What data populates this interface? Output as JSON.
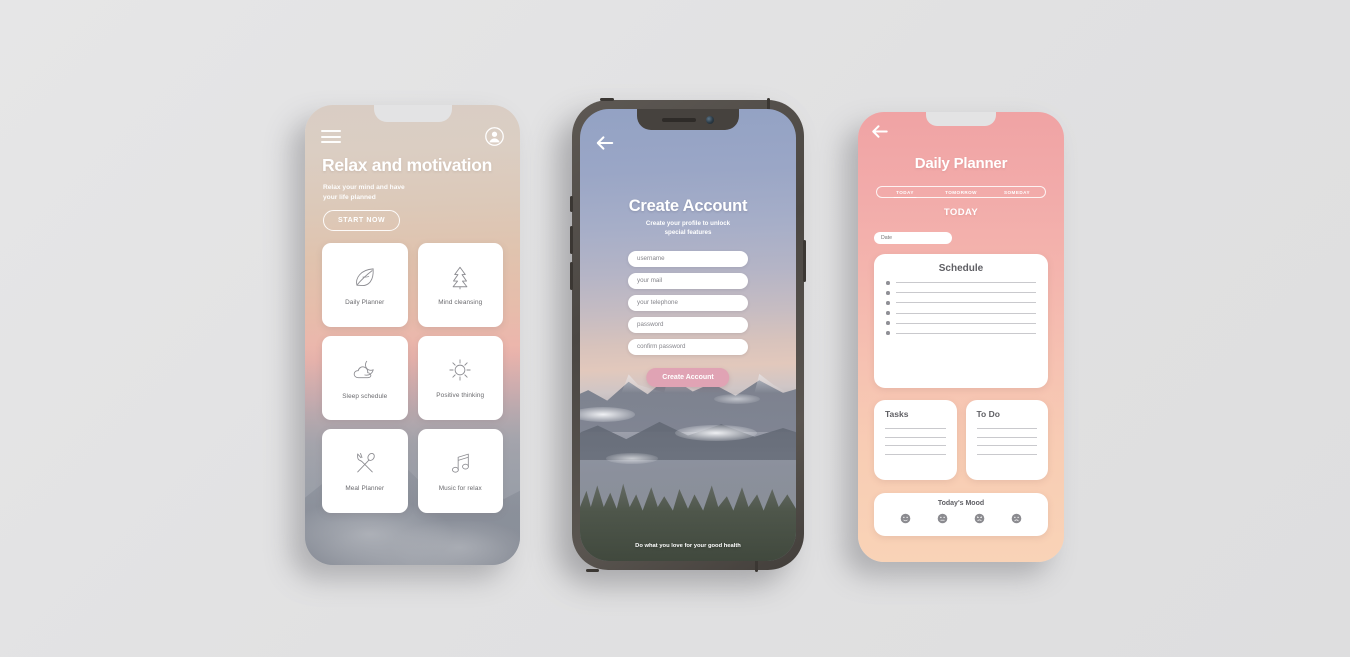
{
  "canvas": {
    "background": "#e3e3e4"
  },
  "phone1": {
    "name": "relax-and-motivation-home",
    "menu_icon": "hamburger-menu-icon",
    "account_icon": "account-avatar-icon",
    "title": "Relax and motivation",
    "subtitle": "Relax your mind and have\nyour life planned",
    "cta_label": "START NOW",
    "tiles": [
      {
        "label": "Daily Planner",
        "icon": "leaf-icon"
      },
      {
        "label": "Mind cleansing",
        "icon": "pine-tree-icon"
      },
      {
        "label": "Sleep schedule",
        "icon": "moon-cloud-icon"
      },
      {
        "label": "Positive thinking",
        "icon": "sun-icon"
      },
      {
        "label": "Meal Planner",
        "icon": "fork-spoon-icon"
      },
      {
        "label": "Music for relax",
        "icon": "music-note-icon"
      }
    ]
  },
  "phone2": {
    "name": "create-account-screen",
    "back_icon": "back-arrow-icon",
    "title": "Create Account",
    "subtitle": "Create your profile to unlock\nspecial features",
    "fields": [
      {
        "placeholder": "username"
      },
      {
        "placeholder": "your mail"
      },
      {
        "placeholder": "your telephone"
      },
      {
        "placeholder": "password"
      },
      {
        "placeholder": "confirm password"
      }
    ],
    "submit_label": "Create Account",
    "submit_color": "#e0a3b4",
    "footer": "Do what you love for your good health"
  },
  "phone3": {
    "name": "daily-planner-screen",
    "back_icon": "back-arrow-icon",
    "title": "Daily Planner",
    "tabs": [
      {
        "label": "TODAY",
        "active": true
      },
      {
        "label": "TOMORROW",
        "active": false
      },
      {
        "label": "SOMEDAY",
        "active": false
      }
    ],
    "day_heading": "TODAY",
    "date_placeholder": "Date",
    "schedule": {
      "heading": "Schedule",
      "rows": 6
    },
    "tasks": {
      "heading": "Tasks",
      "rows": 4
    },
    "todo": {
      "heading": "To Do",
      "rows": 4
    },
    "mood": {
      "heading": "Today's Mood",
      "faces": [
        "happy-face-icon",
        "neutral-face-icon",
        "confounded-face-icon",
        "sad-face-icon"
      ]
    },
    "accent_top": "#f0a3a4",
    "accent_bottom": "#f9d3b7"
  }
}
